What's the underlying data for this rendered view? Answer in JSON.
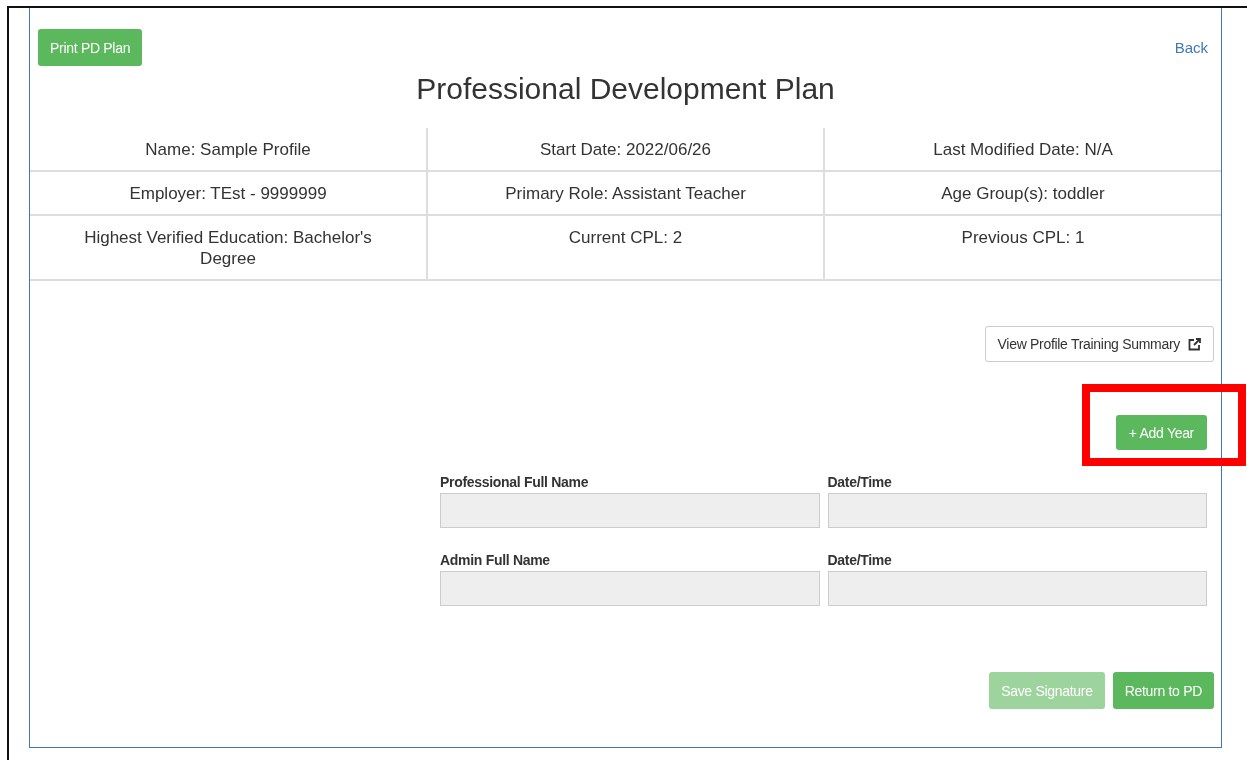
{
  "header": {
    "print_button": "Print PD Plan",
    "back_link": "Back"
  },
  "title": "Professional Development Plan",
  "profile_table": [
    [
      "Name: Sample Profile",
      "Start Date: 2022/06/26",
      "Last Modified Date: N/A"
    ],
    [
      "Employer: TEst - 9999999",
      "Primary Role: Assistant Teacher",
      "Age Group(s): toddler"
    ],
    [
      "Highest Verified Education: Bachelor's Degree",
      "Current CPL: 2",
      "Previous CPL: 1"
    ]
  ],
  "training_summary_button": "View Profile Training Summary",
  "add_year_button": {
    "label": "+ Add Year",
    "highlighted": true
  },
  "signature_fields": [
    {
      "label": "Professional Full Name",
      "disabled": true
    },
    {
      "label": "Date/Time",
      "disabled": true
    },
    {
      "label": "Admin Full Name",
      "disabled": true
    },
    {
      "label": "Date/Time",
      "disabled": true
    }
  ],
  "footer_buttons": [
    {
      "label": "Save Signature",
      "disabled": true
    },
    {
      "label": "Return to PD",
      "disabled": false
    }
  ]
}
